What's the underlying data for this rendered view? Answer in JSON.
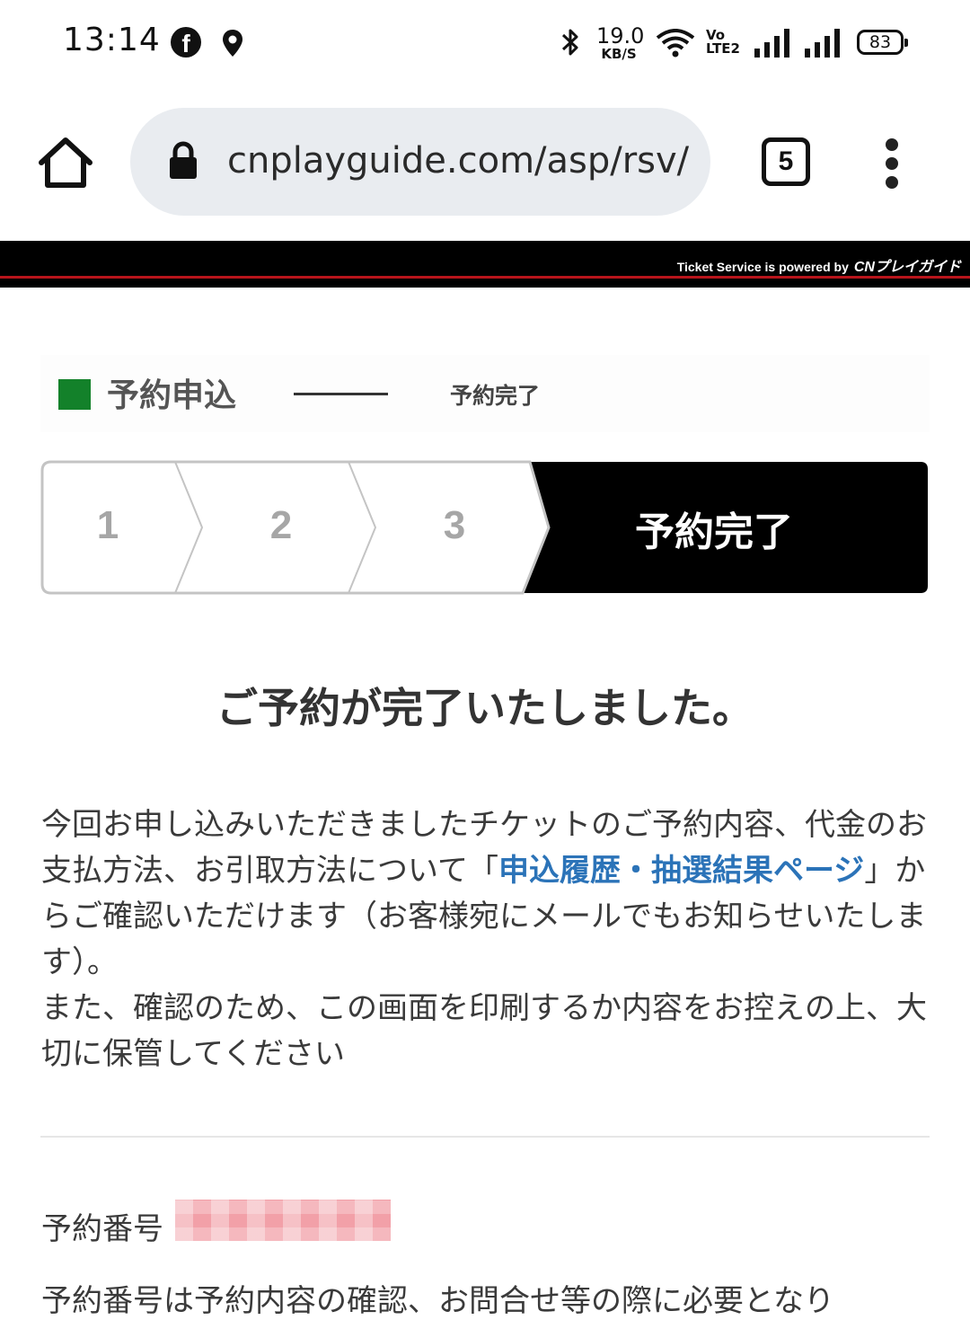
{
  "status_bar": {
    "time": "13:14",
    "speed_value": "19.0",
    "speed_unit": "KB/S",
    "volte": "Vo\nLTE2",
    "battery": "83",
    "icons": [
      "facebook-icon",
      "location-icon",
      "bluetooth-icon",
      "wifi-icon",
      "signal-icon"
    ]
  },
  "browser": {
    "url": "cnplayguide.com/asp/rsv/p",
    "tab_count": "5"
  },
  "banner": {
    "powered_text": "Ticket Service is powered by",
    "logo_text": "CNプレイガイド"
  },
  "step_header": {
    "current": "予約申込",
    "next": "予約完了"
  },
  "progress": {
    "steps": [
      "1",
      "2",
      "3"
    ],
    "done_label": "予約完了"
  },
  "main": {
    "title": "ご予約が完了いたしました。",
    "para1_before": "今回お申し込みいただきましたチケットのご予約内容、代金のお支払方法、お引取方法について「",
    "para1_link": "申込履歴・抽選結果ページ",
    "para1_after": "」からご確認いただけます（お客様宛にメールでもお知らせいたします）。",
    "para2": "また、確認のため、この画面を印刷するか内容をお控えの上、大切に保管してください",
    "reservation_label": "予約番号",
    "reservation_value": "",
    "bottom_text": "予約番号は予約内容の確認、お問合せ等の際に必要となり"
  },
  "colors": {
    "accent_green": "#13812a",
    "link_blue": "#2b73b8",
    "banner_black": "#000000",
    "banner_red": "#b8141b"
  }
}
